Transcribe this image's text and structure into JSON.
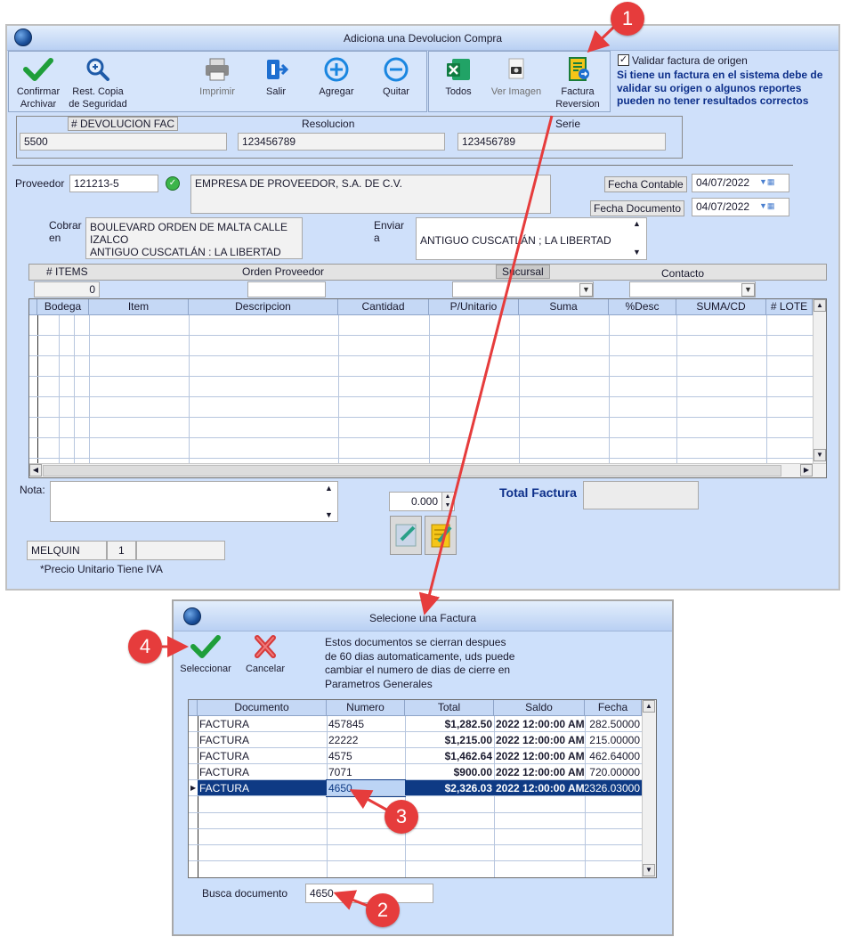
{
  "main_window": {
    "title": "Adiciona una Devolucion Compra",
    "toolbar": {
      "confirm_label": "Confirmar\nArchivar",
      "backup_label": "Rest. Copia\nde Seguridad",
      "print_label": "Imprimir",
      "exit_label": "Salir",
      "add_label": "Agregar",
      "remove_label": "Quitar",
      "all_label": "Todos",
      "view_image_label": "Ver Imagen",
      "invoice_reversal_label": "Factura\nReversion"
    },
    "validate_checkbox_label": "Validar factura de origen",
    "validate_checked": true,
    "validate_note": "Si tiene un factura en el sistema debe de validar su origen o algunos reportes pueden no tener resultados correctos",
    "header_fields": {
      "devolucion_label": "# DEVOLUCION FAC",
      "devolucion_value": "5500",
      "resolucion_label": "Resolucion",
      "resolucion_value": "123456789",
      "serie_label": "Serie",
      "serie_value": "123456789"
    },
    "proveedor_label": "Proveedor",
    "proveedor_code": "121213-5",
    "proveedor_name": "EMPRESA DE PROVEEDOR, S.A. DE C.V.",
    "fecha_contable_label": "Fecha Contable",
    "fecha_contable_value": "04/07/2022",
    "fecha_documento_label": "Fecha Documento",
    "fecha_documento_value": "04/07/2022",
    "cobrar_label": "Cobrar\nen",
    "cobrar_value": "BOULEVARD ORDEN DE MALTA CALLE\nIZALCO\nANTIGUO CUSCATLÁN : LA LIBERTAD",
    "enviar_label": "Enviar\na",
    "enviar_value": "ANTIGUO CUSCATLÁN ; LA LIBERTAD",
    "items_label": "# ITEMS",
    "items_value": "0",
    "orden_label": "Orden Proveedor",
    "sucursal_label": "Sucursal",
    "contacto_label": "Contacto",
    "grid_columns": [
      "Bodega",
      "Item",
      "Descripcion",
      "Cantidad",
      "P/Unitario",
      "Suma",
      "%Desc",
      "SUMA/CD",
      "# LOTE"
    ],
    "nota_label": "Nota:",
    "amount_value": "0.000",
    "total_label": "Total Factura",
    "user_name": "MELQUIN",
    "user_num": "1",
    "footnote": "*Precio Unitario Tiene IVA"
  },
  "dialog": {
    "title": "Selecione una Factura",
    "select_label": "Seleccionar",
    "cancel_label": "Cancelar",
    "info_text": "Estos documentos se cierran despues\nde 60 dias automaticamente, uds puede\ncambiar el numero de dias de cierre en\nParametros Generales",
    "columns": [
      "Documento",
      "Numero",
      "Total",
      "Saldo",
      "Fecha"
    ],
    "rows": [
      {
        "doc": "FACTURA",
        "num": "457845",
        "total": "$1,282.50",
        "saldo": "2022 12:00:00 AM",
        "fecha": "282.50000"
      },
      {
        "doc": "FACTURA",
        "num": "22222",
        "total": "$1,215.00",
        "saldo": "2022 12:00:00 AM",
        "fecha": "215.00000"
      },
      {
        "doc": "FACTURA",
        "num": "4575",
        "total": "$1,462.64",
        "saldo": "2022 12:00:00 AM",
        "fecha": "462.64000"
      },
      {
        "doc": "FACTURA",
        "num": "7071",
        "total": "$900.00",
        "saldo": "2022 12:00:00 AM",
        "fecha": "720.00000"
      },
      {
        "doc": "FACTURA",
        "num": "4650",
        "total": "$2,326.03",
        "saldo": "2022 12:00:00 AM",
        "fecha": "2326.03000"
      }
    ],
    "search_label": "Busca documento",
    "search_value": "4650"
  },
  "callouts": [
    "1",
    "2",
    "3",
    "4"
  ],
  "colors": {
    "callout": "#e63c3c",
    "selected_row": "#0e3a84",
    "window_bg": "#cfe0fa"
  }
}
